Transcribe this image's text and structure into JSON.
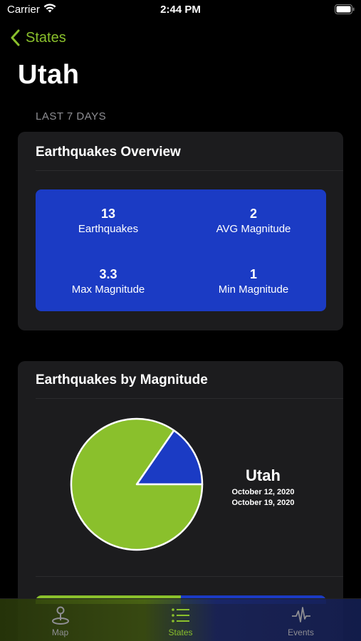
{
  "status": {
    "carrier": "Carrier",
    "time": "2:44 PM"
  },
  "nav": {
    "back_label": "States"
  },
  "page": {
    "title": "Utah",
    "section_label": "LAST 7 DAYS"
  },
  "overview": {
    "title": "Earthquakes Overview",
    "stats": [
      {
        "value": "13",
        "label": "Earthquakes"
      },
      {
        "value": "2",
        "label": "AVG Magnitude"
      },
      {
        "value": "3.3",
        "label": "Max Magnitude"
      },
      {
        "value": "1",
        "label": "Min Magnitude"
      }
    ]
  },
  "magnitude": {
    "title": "Earthquakes by Magnitude",
    "legend_state": "Utah",
    "date_start": "October 12, 2020",
    "date_end": "October 19, 2020"
  },
  "chart_data": {
    "type": "pie",
    "slices": [
      {
        "value": 11,
        "color": "#8ac02c"
      },
      {
        "value": 2,
        "color": "#1b3bc4"
      }
    ]
  },
  "tabs": [
    {
      "label": "Map",
      "icon": "map-pin-icon"
    },
    {
      "label": "States",
      "icon": "list-icon"
    },
    {
      "label": "Events",
      "icon": "waveform-icon"
    }
  ],
  "colors": {
    "accent": "#8ac02c",
    "stats_bg": "#1b3bc4",
    "card_bg": "#1c1c1e"
  }
}
